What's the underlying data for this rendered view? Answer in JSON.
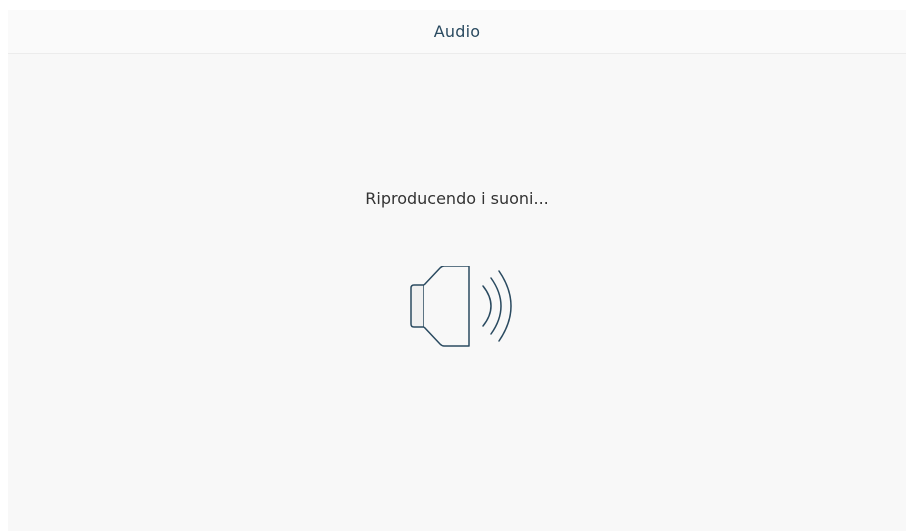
{
  "header": {
    "title": "Audio"
  },
  "main": {
    "status_text": "Riproducendo i suoni...",
    "icon": "speaker-volume-icon"
  },
  "colors": {
    "header_text": "#2a4a60",
    "icon_stroke": "#2a4a60",
    "icon_fill": "#f0f0f0",
    "body_text": "#333333",
    "background": "#f8f8f8"
  }
}
